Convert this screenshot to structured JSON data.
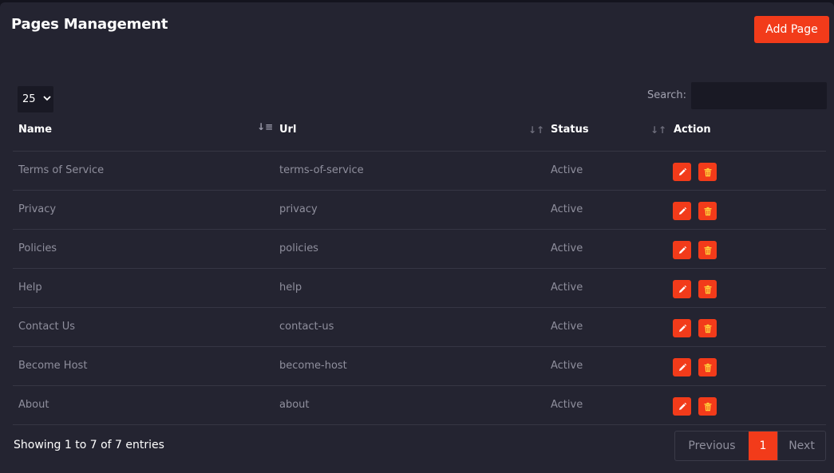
{
  "page": {
    "title": "Pages Management"
  },
  "toolbar": {
    "add_label": "Add Page"
  },
  "table_controls": {
    "page_length": "25",
    "search_label": "Search:",
    "search_value": ""
  },
  "table": {
    "columns": [
      "Name",
      "Url",
      "Status",
      "Action"
    ],
    "rows": [
      {
        "name": "Terms of Service",
        "url": "terms-of-service",
        "status": "Active"
      },
      {
        "name": "Privacy",
        "url": "privacy",
        "status": "Active"
      },
      {
        "name": "Policies",
        "url": "policies",
        "status": "Active"
      },
      {
        "name": "Help",
        "url": "help",
        "status": "Active"
      },
      {
        "name": "Contact Us",
        "url": "contact-us",
        "status": "Active"
      },
      {
        "name": "Become Host",
        "url": "become-host",
        "status": "Active"
      },
      {
        "name": "About",
        "url": "about",
        "status": "Active"
      }
    ],
    "action_icons": [
      "pencil-icon",
      "trash-icon"
    ]
  },
  "footer": {
    "info": "Showing 1 to 7 of 7 entries",
    "pagination": {
      "previous": "Previous",
      "current": "1",
      "next": "Next"
    }
  },
  "colors": {
    "accent": "#f23b1a",
    "panel": "#242431",
    "background": "#14141e"
  }
}
